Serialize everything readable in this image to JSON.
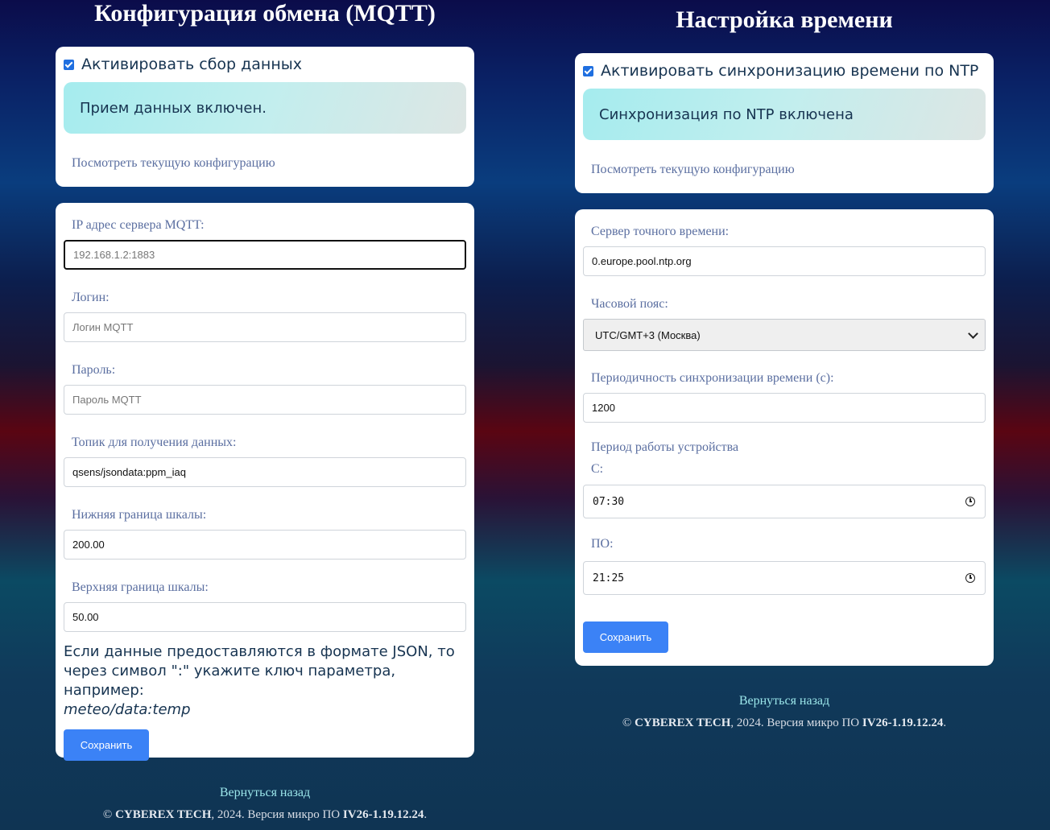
{
  "mqtt": {
    "title": "Конфигурация обмена (MQTT)",
    "activate_label": "Активировать сбор данных",
    "status": "Прием данных включен.",
    "view_config": "Посмотреть текущую конфигурацию",
    "server_label": "IP адрес сервера MQTT:",
    "server_placeholder": "192.168.1.2:1883",
    "login_label": "Логин:",
    "login_placeholder": "Логин MQTT",
    "password_label": "Пароль:",
    "password_placeholder": "Пароль MQTT",
    "topic_label": "Топик для получения данных:",
    "topic_value": "qsens/jsondata:ppm_iaq",
    "lower_label": "Нижняя граница шкалы:",
    "lower_value": "200.00",
    "upper_label": "Верхняя граница шкалы:",
    "upper_value": "50.00",
    "hint_text": "Если данные предоставляются в формате JSON, то через символ \":\" укажите ключ параметра, например:",
    "hint_example": "meteo/data:temp",
    "save_label": "Сохранить",
    "back_label": "Вернуться назад"
  },
  "time": {
    "title": "Настройка времени",
    "activate_label": "Активировать синхронизацию времени по NTP",
    "status": "Синхронизация по NTP включена",
    "view_config": "Посмотреть текущую конфигурацию",
    "server_label": "Сервер точного времени:",
    "server_value": "0.europe.pool.ntp.org",
    "tz_label": "Часовой пояс:",
    "tz_value": "UTC/GMT+3 (Москва)",
    "period_label": "Периодичность синхронизации времени (с):",
    "period_value": "1200",
    "work_label": "Период работы устройства",
    "from_label": "С:",
    "from_value": "07:30",
    "to_label": "ПО:",
    "to_value": "21:25",
    "save_label": "Сохранить",
    "back_label": "Вернуться назад"
  },
  "footer": {
    "copyright": "©",
    "company": "CYBEREX TECH",
    "year_text": ", 2024. Версия микро ПО",
    "version": "IV26-1.19.12.24",
    "end": "."
  }
}
